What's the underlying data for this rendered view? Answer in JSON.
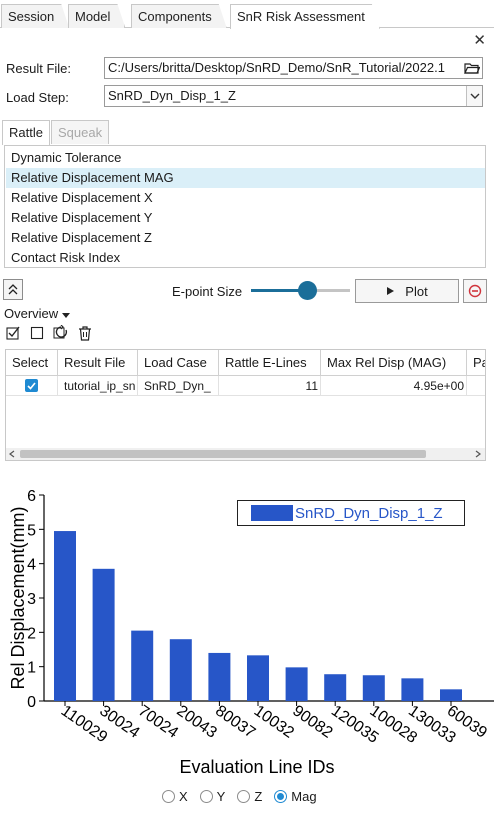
{
  "tabs": [
    "Session",
    "Model",
    "Components",
    "SnR Risk Assessment"
  ],
  "close_glyph": "✕",
  "fields": {
    "result_file_label": "Result File:",
    "result_file_value": "C:/Users/britta/Desktop/SnRD_Demo/SnR_Tutorial/2022.1",
    "load_step_label": "Load Step:",
    "load_step_value": "SnRD_Dyn_Disp_1_Z"
  },
  "sub_tabs": [
    "Rattle",
    "Squeak"
  ],
  "result_types": {
    "items": [
      "Dynamic Tolerance",
      "Relative Displacement MAG",
      "Relative Displacement X",
      "Relative Displacement Y",
      "Relative Displacement Z",
      "Contact Risk Index"
    ],
    "selected_index": 1
  },
  "controls": {
    "epoint_label": "E-point Size",
    "epoint_value_fraction": 0.57,
    "plot_label": "Plot",
    "overview_label": "Overview"
  },
  "table": {
    "headers": [
      "Select",
      "Result File",
      "Load Case",
      "Rattle E-Lines",
      "Max Rel Disp (MAG)",
      "Pa"
    ],
    "rows": [
      {
        "selected": true,
        "result_file": "tutorial_ip_sn",
        "load_case": "SnRD_Dyn_",
        "rattle_elines": "11",
        "max_rel_disp": "4.95e+00"
      }
    ]
  },
  "chart_data": {
    "type": "bar",
    "categories": [
      "110029",
      "30024",
      "70024",
      "20043",
      "80037",
      "10032",
      "90082",
      "120035",
      "100028",
      "130033",
      "60039"
    ],
    "series": [
      {
        "name": "SnRD_Dyn_Disp_1_Z",
        "values": [
          4.95,
          3.85,
          2.05,
          1.8,
          1.4,
          1.33,
          0.98,
          0.78,
          0.75,
          0.66,
          0.34
        ]
      }
    ],
    "ylabel": "Rel Displacement(mm)",
    "xlabel": "Evaluation Line IDs",
    "ylim": [
      0,
      6
    ],
    "yticks": [
      "0",
      "1",
      "2",
      "3",
      "4",
      "5",
      "6"
    ],
    "grid": false,
    "legend": "top-right",
    "bar_color": "#2756c8"
  },
  "radios": {
    "options": [
      "X",
      "Y",
      "Z",
      "Mag"
    ],
    "selected_index": 3
  },
  "colors": {
    "accent": "#1f8ad2",
    "slider": "#1b6e99",
    "selected_row": "#daeff8",
    "stop": "#d0343c"
  }
}
